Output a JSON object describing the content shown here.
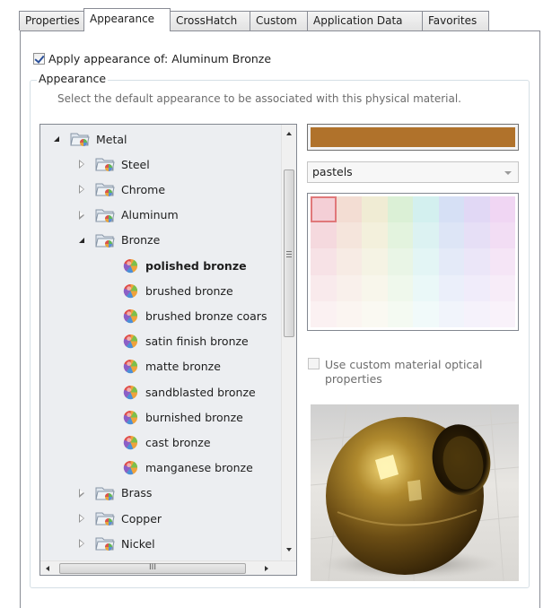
{
  "tabs": [
    {
      "label": "Properties",
      "active": false
    },
    {
      "label": "Appearance",
      "active": true
    },
    {
      "label": "CrossHatch",
      "active": false
    },
    {
      "label": "Custom",
      "active": false
    },
    {
      "label": "Application Data",
      "active": false
    },
    {
      "label": "Favorites",
      "active": false
    }
  ],
  "apply": {
    "checked": true,
    "label": "Apply appearance of: Aluminum Bronze"
  },
  "group": {
    "title": "Appearance",
    "description": "Select the default appearance to be associated with this physical material."
  },
  "tree": {
    "nodes": [
      {
        "label": "Metal",
        "level": 0,
        "type": "folder",
        "state": "expanded"
      },
      {
        "label": "Steel",
        "level": 1,
        "type": "folder",
        "state": "collapsed"
      },
      {
        "label": "Chrome",
        "level": 1,
        "type": "folder",
        "state": "collapsed"
      },
      {
        "label": "Aluminum",
        "level": 1,
        "type": "folder",
        "state": "collapsed"
      },
      {
        "label": "Bronze",
        "level": 1,
        "type": "folder",
        "state": "expanded"
      },
      {
        "label": "polished bronze",
        "level": 2,
        "type": "appearance",
        "selected": true
      },
      {
        "label": "brushed bronze",
        "level": 2,
        "type": "appearance"
      },
      {
        "label": "brushed bronze coars",
        "level": 2,
        "type": "appearance"
      },
      {
        "label": "satin finish bronze",
        "level": 2,
        "type": "appearance"
      },
      {
        "label": "matte bronze",
        "level": 2,
        "type": "appearance"
      },
      {
        "label": "sandblasted bronze",
        "level": 2,
        "type": "appearance"
      },
      {
        "label": "burnished bronze",
        "level": 2,
        "type": "appearance"
      },
      {
        "label": "cast bronze",
        "level": 2,
        "type": "appearance"
      },
      {
        "label": "manganese bronze",
        "level": 2,
        "type": "appearance"
      },
      {
        "label": "Brass",
        "level": 1,
        "type": "folder",
        "state": "collapsed"
      },
      {
        "label": "Copper",
        "level": 1,
        "type": "folder",
        "state": "collapsed"
      },
      {
        "label": "Nickel",
        "level": 1,
        "type": "folder",
        "state": "collapsed"
      }
    ],
    "hscroll_grip": "III",
    "vscroll_grip": "≡"
  },
  "color_swatch": "#b0722b",
  "palette": {
    "selected_value": "pastels",
    "cols": 8,
    "rows": 5,
    "colors": [
      [
        "#f4cfd6",
        "#f3ddd3",
        "#f0ecd4",
        "#dbf0d6",
        "#d3f0ef",
        "#d6e0f5",
        "#e1d8f5",
        "#f0d6f3"
      ],
      [
        "#f5d9de",
        "#f5e5dc",
        "#f3f0dc",
        "#e3f3de",
        "#dcf2f2",
        "#dde5f6",
        "#e6dff6",
        "#f2ddf4"
      ],
      [
        "#f7e2e6",
        "#f7ebe4",
        "#f5f3e4",
        "#e9f5e6",
        "#e3f5f5",
        "#e4eaf8",
        "#ebe6f8",
        "#f5e5f6"
      ],
      [
        "#f9eaec",
        "#f9f0eb",
        "#f8f6eb",
        "#eff8ec",
        "#eaf8f8",
        "#ebeffa",
        "#f0ecfa",
        "#f7ecf8"
      ],
      [
        "#fbf1f2",
        "#fbf5f1",
        "#faf9f2",
        "#f4faf2",
        "#f1fafa",
        "#f1f4fb",
        "#f5f2fb",
        "#f9f2fa"
      ]
    ]
  },
  "custom_optical": {
    "checked": false,
    "enabled": false,
    "label": "Use custom material optical properties"
  },
  "colors": {
    "accent": "#2a4f9a",
    "border": "#898c95",
    "tree_bg": "#eceef1"
  }
}
